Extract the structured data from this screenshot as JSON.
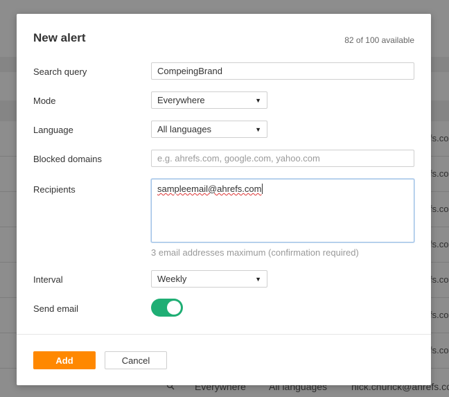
{
  "dialog": {
    "title": "New alert",
    "availability": "82 of 100 available"
  },
  "form": {
    "search_query": {
      "label": "Search query",
      "value": "CompeingBrand"
    },
    "mode": {
      "label": "Mode",
      "value": "Everywhere"
    },
    "language": {
      "label": "Language",
      "value": "All languages"
    },
    "blocked_domains": {
      "label": "Blocked domains",
      "value": "",
      "placeholder": "e.g. ahrefs.com, google.com, yahoo.com"
    },
    "recipients": {
      "label": "Recipients",
      "value": "sampleemail@ahrefs.com",
      "hint": "3 email addresses maximum (confirmation required)"
    },
    "interval": {
      "label": "Interval",
      "value": "Weekly"
    },
    "send_email": {
      "label": "Send email",
      "enabled": true
    }
  },
  "buttons": {
    "add": "Add",
    "cancel": "Cancel"
  },
  "background": {
    "row_emails": [
      "fs.com",
      "fs.com",
      "fs.com",
      "fs.com",
      "fs.com",
      "fs.com",
      "fs.com"
    ],
    "footer_row": {
      "mode": "Everywhere",
      "language": "All languages",
      "email": "nick.churick@ahrefs.com"
    }
  },
  "colors": {
    "accent": "#ff8800",
    "toggle_on": "#1fae74",
    "focus_border": "#9ec1e6"
  }
}
